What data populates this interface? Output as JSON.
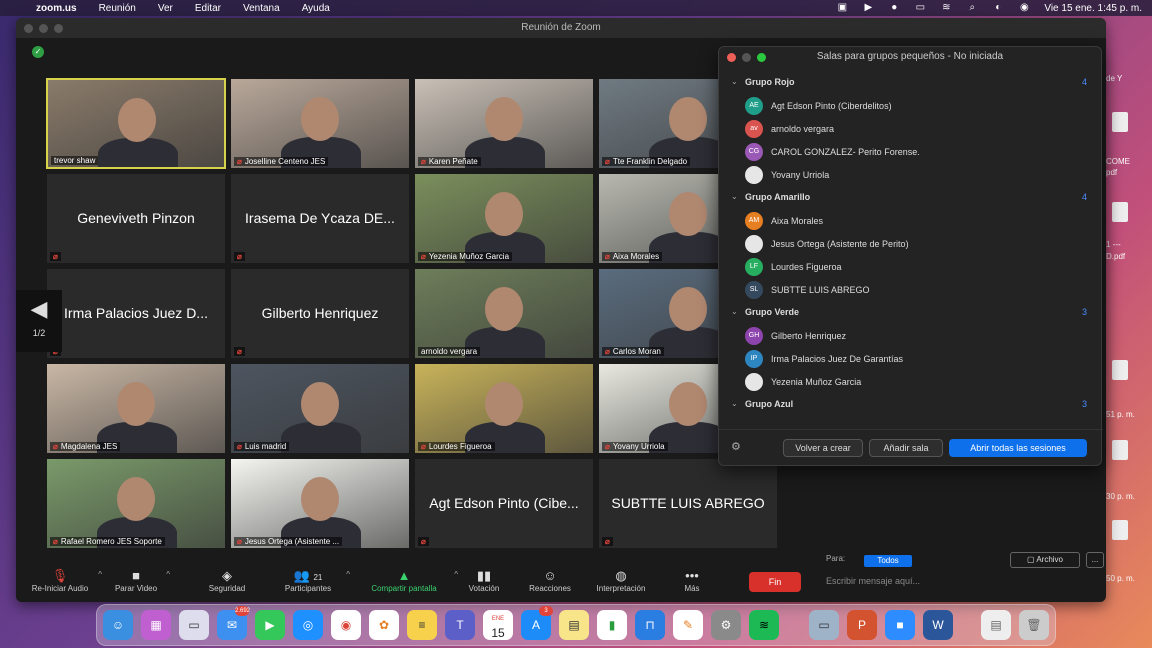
{
  "menubar": {
    "app": "zoom.us",
    "items": [
      "Reunión",
      "Ver",
      "Editar",
      "Ventana",
      "Ayuda"
    ],
    "datetime": "Vie 15 ene.  1:45 p. m."
  },
  "window": {
    "title": "Reunión de Zoom"
  },
  "tiles": [
    {
      "name": "trevor shaw",
      "video": true,
      "muted": false,
      "active": true,
      "bg": "#8a7b6a"
    },
    {
      "name": "Joselline Centeno JES",
      "video": true,
      "muted": true,
      "bg": "#b9a89a"
    },
    {
      "name": "Karen Peñate",
      "video": true,
      "muted": true,
      "bg": "#c9c0b6"
    },
    {
      "name": "Tte Franklin Delgado",
      "video": true,
      "muted": true,
      "bg": "#6f7a82"
    },
    {
      "name": "Geneviveth Pinzon",
      "video": false,
      "muted": true
    },
    {
      "name": "Irasema De Ycaza DE...",
      "video": false,
      "muted": true
    },
    {
      "name": "Yezenia Muñoz Garcia",
      "video": true,
      "muted": true,
      "bg": "#7b8f5c"
    },
    {
      "name": "Aixa Morales",
      "video": true,
      "muted": true,
      "bg": "#b8b8b0"
    },
    {
      "name": "Irma Palacios Juez D...",
      "video": false,
      "muted": true
    },
    {
      "name": "Gilberto Henriquez",
      "video": false,
      "muted": true
    },
    {
      "name": "arnoldo vergara",
      "video": true,
      "muted": false,
      "bg": "#6e7e5a"
    },
    {
      "name": "Carlos Moran",
      "video": true,
      "muted": true,
      "bg": "#5a6c7e"
    },
    {
      "name": "Magdalena JES",
      "video": true,
      "muted": true,
      "bg": "#c9b7a5"
    },
    {
      "name": "Luis madrid",
      "video": true,
      "muted": true,
      "bg": "#4d5560"
    },
    {
      "name": "Lourdes Figueroa",
      "video": true,
      "muted": true,
      "bg": "#c8b35a"
    },
    {
      "name": "Yovany Urriola",
      "video": true,
      "muted": true,
      "bg": "#e8e8e0"
    },
    {
      "name": "Rafael Romero JES Soporte",
      "video": true,
      "muted": true,
      "bg": "#7a9a6a"
    },
    {
      "name": "Jesus Ortega (Asistente ...",
      "video": true,
      "muted": true,
      "bg": "#f4f4f0"
    },
    {
      "name": "Agt Edson Pinto (Cibe...",
      "video": false,
      "muted": true
    },
    {
      "name": "SUBTTE LUIS ABREGO",
      "video": false,
      "muted": true
    }
  ],
  "pager": {
    "label": "1/2"
  },
  "toolbar": {
    "unmute": "Re-Iniciar Audio",
    "video": "Parar Video",
    "security": "Seguridad",
    "participants": "Participantes",
    "participants_count": "21",
    "share": "Compartir pantalla",
    "polls": "Votación",
    "reactions": "Reacciones",
    "interpretation": "Interpretación",
    "more": "Más",
    "end": "Fin"
  },
  "breakout": {
    "title": "Salas para grupos pequeños - No iniciada",
    "groups": [
      {
        "name": "Grupo Rojo",
        "count": "4",
        "members": [
          {
            "initials": "AE",
            "name": "Agt Edson Pinto (Ciberdelitos)",
            "color": "#1f9e8a"
          },
          {
            "initials": "av",
            "name": "arnoldo vergara",
            "color": "#d9534f"
          },
          {
            "initials": "CG",
            "name": "CAROL GONZALEZ- Perito Forense.",
            "color": "#9b59b6"
          },
          {
            "initials": "",
            "name": "Yovany Urriola",
            "color": "#e6e6e6"
          }
        ]
      },
      {
        "name": "Grupo Amarillo",
        "count": "4",
        "members": [
          {
            "initials": "AM",
            "name": "Aixa Morales",
            "color": "#e67e22"
          },
          {
            "initials": "",
            "name": "Jesus Ortega (Asistente de Perito)",
            "color": "#e6e6e6"
          },
          {
            "initials": "LF",
            "name": "Lourdes Figueroa",
            "color": "#27ae60"
          },
          {
            "initials": "SL",
            "name": "SUBTTE LUIS ABREGO",
            "color": "#34495e"
          }
        ]
      },
      {
        "name": "Grupo Verde",
        "count": "3",
        "members": [
          {
            "initials": "GH",
            "name": "Gilberto Henriquez",
            "color": "#8e44ad"
          },
          {
            "initials": "IP",
            "name": "Irma Palacios Juez De Garantías",
            "color": "#2e86c1"
          },
          {
            "initials": "",
            "name": "Yezenia Muñoz Garcia",
            "color": "#e6e6e6"
          }
        ]
      },
      {
        "name": "Grupo Azul",
        "count": "3",
        "members": []
      }
    ],
    "recreate": "Volver a crear",
    "add_room": "Añadir sala",
    "open_all": "Abrir todas las sesiones"
  },
  "chat": {
    "to_label": "Para:",
    "to_value": "Todos",
    "file": "Archivo",
    "more": "...",
    "placeholder": "Escribir mensaje aquí..."
  },
  "desktop": {
    "labels": [
      "de Y",
      "COME",
      "pdf",
      "1 ---",
      "D.pdf",
      "51 p. m.",
      "30 p. m.",
      "50 p. m."
    ]
  },
  "dock": {
    "mail_badge": "2.692",
    "appstore_badge": "3",
    "calendar_day": "15",
    "calendar_month": "ENE"
  }
}
